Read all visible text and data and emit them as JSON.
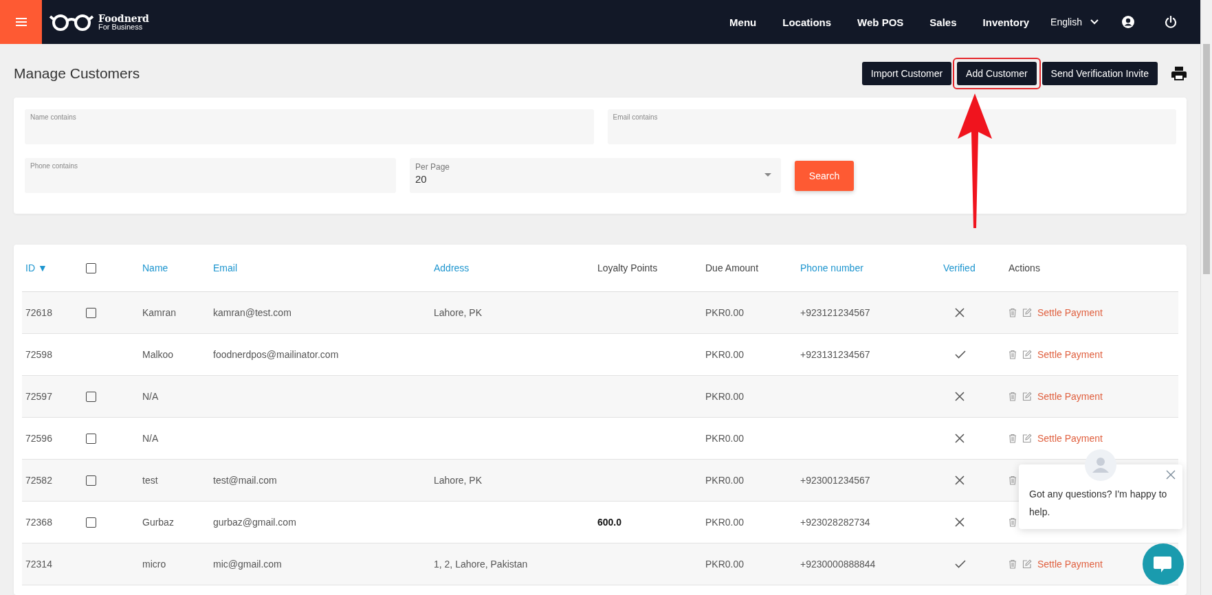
{
  "header": {
    "brand": "Foodnerd",
    "tagline": "For Business",
    "nav": [
      {
        "label": "Menu"
      },
      {
        "label": "Locations"
      },
      {
        "label": "Web POS"
      },
      {
        "label": "Sales"
      },
      {
        "label": "Inventory"
      }
    ],
    "language": "English"
  },
  "page": {
    "title": "Manage Customers",
    "actions": [
      {
        "label": "Import Customer",
        "highlighted": false
      },
      {
        "label": "Add Customer",
        "highlighted": true
      },
      {
        "label": "Send Verification Invite",
        "highlighted": false
      }
    ]
  },
  "filters": {
    "name": {
      "label": "Name contains"
    },
    "email": {
      "label": "Email contains"
    },
    "phone": {
      "label": "Phone contains"
    },
    "per_page": {
      "label": "Per Page",
      "value": "20"
    },
    "search_button": "Search"
  },
  "table": {
    "columns": [
      {
        "kind": "text",
        "label": "ID",
        "sortable": true,
        "sort_mark": "▼"
      },
      {
        "kind": "checkbox",
        "checked": false
      },
      {
        "kind": "text",
        "label": "Name",
        "sortable": true
      },
      {
        "kind": "text",
        "label": "Email",
        "sortable": true
      },
      {
        "kind": "text",
        "label": "Address",
        "sortable": true
      },
      {
        "kind": "text",
        "label": "Loyalty Points",
        "sortable": false
      },
      {
        "kind": "text",
        "label": "Due Amount",
        "sortable": false
      },
      {
        "kind": "text",
        "label": "Phone number",
        "sortable": true
      },
      {
        "kind": "text",
        "label": "Verified",
        "sortable": true
      },
      {
        "kind": "text",
        "label": "Actions",
        "sortable": false
      }
    ],
    "rows": [
      {
        "id": "72618",
        "checked": false,
        "name": "Kamran",
        "email": "kamran@test.com",
        "address": "Lahore, PK",
        "due": "PKR0.00",
        "phone": "+923121234567",
        "verified": false,
        "action": "Settle Payment"
      },
      {
        "id": "72598",
        "name": "Malkoo",
        "email": "foodnerdpos@mailinator.com",
        "due": "PKR0.00",
        "phone": "+923131234567",
        "verified": true,
        "action": "Settle Payment"
      },
      {
        "id": "72597",
        "checked": false,
        "name": "N/A",
        "due": "PKR0.00",
        "verified": false,
        "action": "Settle Payment"
      },
      {
        "id": "72596",
        "checked": false,
        "name": "N/A",
        "due": "PKR0.00",
        "verified": false,
        "action": "Settle Payment"
      },
      {
        "id": "72582",
        "checked": false,
        "name": "test",
        "email": "test@mail.com",
        "address": "Lahore, PK",
        "due": "PKR0.00",
        "phone": "+923001234567",
        "verified": false
      },
      {
        "id": "72368",
        "checked": false,
        "name": "Gurbaz",
        "email": "gurbaz@gmail.com",
        "loyalty": "600.0",
        "due": "PKR0.00",
        "phone": "+923028282734",
        "verified": false
      },
      {
        "id": "72314",
        "name": "micro",
        "email": "mic@gmail.com",
        "address": "1, 2, Lahore, Pakistan",
        "due": "PKR0.00",
        "phone": "+9230000888844",
        "verified": true,
        "action": "Settle Payment"
      }
    ]
  },
  "chat": {
    "message": "Got any questions? I'm happy to help."
  }
}
